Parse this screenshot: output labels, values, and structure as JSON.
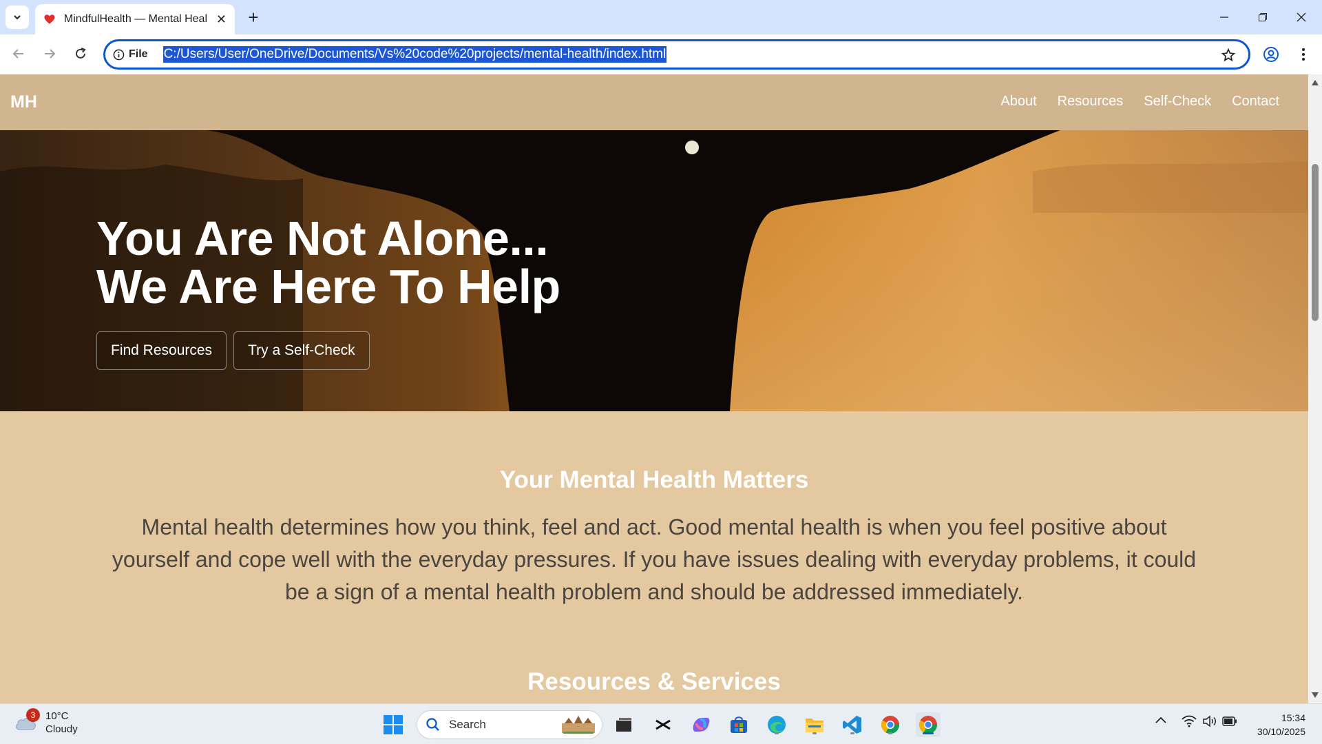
{
  "browser": {
    "tab_title": "MindfulHealth — Mental Health",
    "omnibox_scheme": "File",
    "url": "C:/Users/User/OneDrive/Documents/Vs%20code%20projects/mental-health/index.html"
  },
  "site": {
    "logo": "MH",
    "nav": [
      "About",
      "Resources",
      "Self-Check",
      "Contact"
    ],
    "hero": {
      "title_line1": "You Are Not Alone...",
      "title_line2": "We Are Here To Help",
      "primary_button": "Find Resources",
      "secondary_button": "Try a Self-Check"
    },
    "intro": {
      "heading": "Your Mental Health Matters",
      "body": "Mental health determines how you think, feel and act. Good mental health is when you feel positive about yourself and cope well with the everyday pressures. If you have issues dealing with everyday problems, it could be a sign of a mental health problem and should be addressed immediately."
    },
    "next_section_heading": "Resources & Services"
  },
  "taskbar": {
    "weather_temp": "10°C",
    "weather_desc": "Cloudy",
    "weather_badge": "3",
    "search_label": "Search",
    "time": "15:34",
    "date": "30/10/2025"
  },
  "colors": {
    "nav_bg": "#d1b58f",
    "page_bg": "#e3c8a0",
    "accent": "#0b57d0"
  }
}
